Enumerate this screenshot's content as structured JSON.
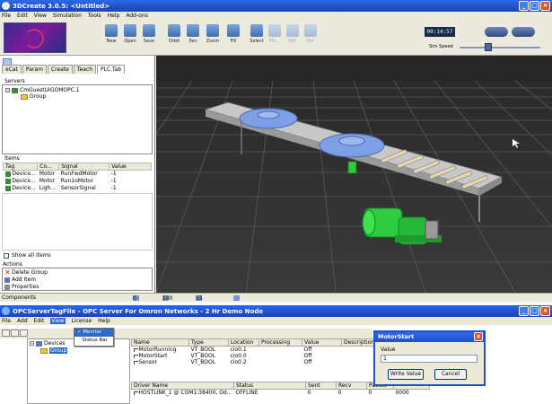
{
  "main_window": {
    "title": "3DCreate 3.0.5: <Untitled>",
    "menu": [
      "File",
      "Edit",
      "View",
      "Simulation",
      "Tools",
      "Help",
      "Add-ons"
    ],
    "toolbar": {
      "buttons": [
        "New",
        "Open",
        "Save",
        "Orbit",
        "Pan",
        "Zoom",
        "Fill",
        "Select",
        "Mo...",
        "Rot",
        "Ref"
      ],
      "clock": "00:14:57",
      "sim_speed_label": "Sim Speed",
      "sim_speed_value": 0.3
    },
    "left_panel": {
      "tabs": [
        "eCat",
        "Param",
        "Create",
        "Teach",
        "PLC Tab"
      ],
      "active_tab": "PLC Tab",
      "servers_label": "Servers",
      "server_name": "CmGuestUIGOMOPC.1",
      "group_name": "Group",
      "items_label": "Items",
      "items_columns": [
        "Tag",
        "Co...",
        "Signal",
        "Value"
      ],
      "items_rows": [
        {
          "tag": "Device...",
          "co": "Motor",
          "signal": "RunFwdMotor",
          "value": "-1"
        },
        {
          "tag": "Device...",
          "co": "Motor",
          "signal": "Run1oMotor",
          "value": "-1"
        },
        {
          "tag": "Device...",
          "co": "Ligh...",
          "signal": "SensorSignal",
          "value": "-1"
        }
      ],
      "show_all_items": "Show all items",
      "actions_label": "Actions",
      "actions": [
        "Delete Group",
        "Add Item",
        "Properties"
      ]
    },
    "status_bar": {
      "components_label": "Components",
      "values": [
        "0",
        "100",
        "15"
      ]
    }
  },
  "opc_window": {
    "title": "OPCServerTagFile - OPC Server For Omron Networks - 2 Hr Demo Node",
    "menu": [
      "File",
      "Add",
      "Edit",
      "View",
      "License",
      "Help"
    ],
    "view_menu": [
      "Monitor",
      "Status Bar"
    ],
    "tree": {
      "root": "Devices",
      "child": "Group"
    },
    "tag_columns": [
      "Name",
      "Type",
      "Location",
      "Processing",
      "Value",
      "Description"
    ],
    "tag_rows": [
      {
        "name": "MotorRunning",
        "type": "VT_BOOL",
        "location": "cio0.1",
        "processing": "",
        "value": "Off"
      },
      {
        "name": "MotorStart",
        "type": "VT_BOOL",
        "location": "cio0.0",
        "processing": "",
        "value": "Off"
      },
      {
        "name": "Sensor",
        "type": "VT_BOOL",
        "location": "cio0.2",
        "processing": "",
        "value": "Off"
      }
    ],
    "driver_columns": [
      "Driver Name",
      "Status",
      "Sent",
      "Recv",
      "Packet"
    ],
    "driver_rows": [
      {
        "name": "HOSTLINK_1 @ COM1:38400, Od...",
        "status": "OFFLINE",
        "sent": "0",
        "recv": "0",
        "packet": "0",
        "extra": "0000"
      }
    ]
  },
  "dialog": {
    "title": "MotorStart",
    "value_label": "Value",
    "value": "1",
    "write_button": "Write Value",
    "cancel_button": "Cancel"
  },
  "colors": {
    "title_bar": "#1f50c8",
    "viewport_bg": "#262626",
    "conveyor_plate": "#7d9fe6",
    "motor_green": "#2ecc40"
  },
  "icons": [
    "app-icon",
    "minimize-icon",
    "maximize-icon",
    "close-icon",
    "folder-icon",
    "server-icon",
    "device-icon",
    "delete-icon",
    "add-icon",
    "properties-icon",
    "tag-icon"
  ]
}
